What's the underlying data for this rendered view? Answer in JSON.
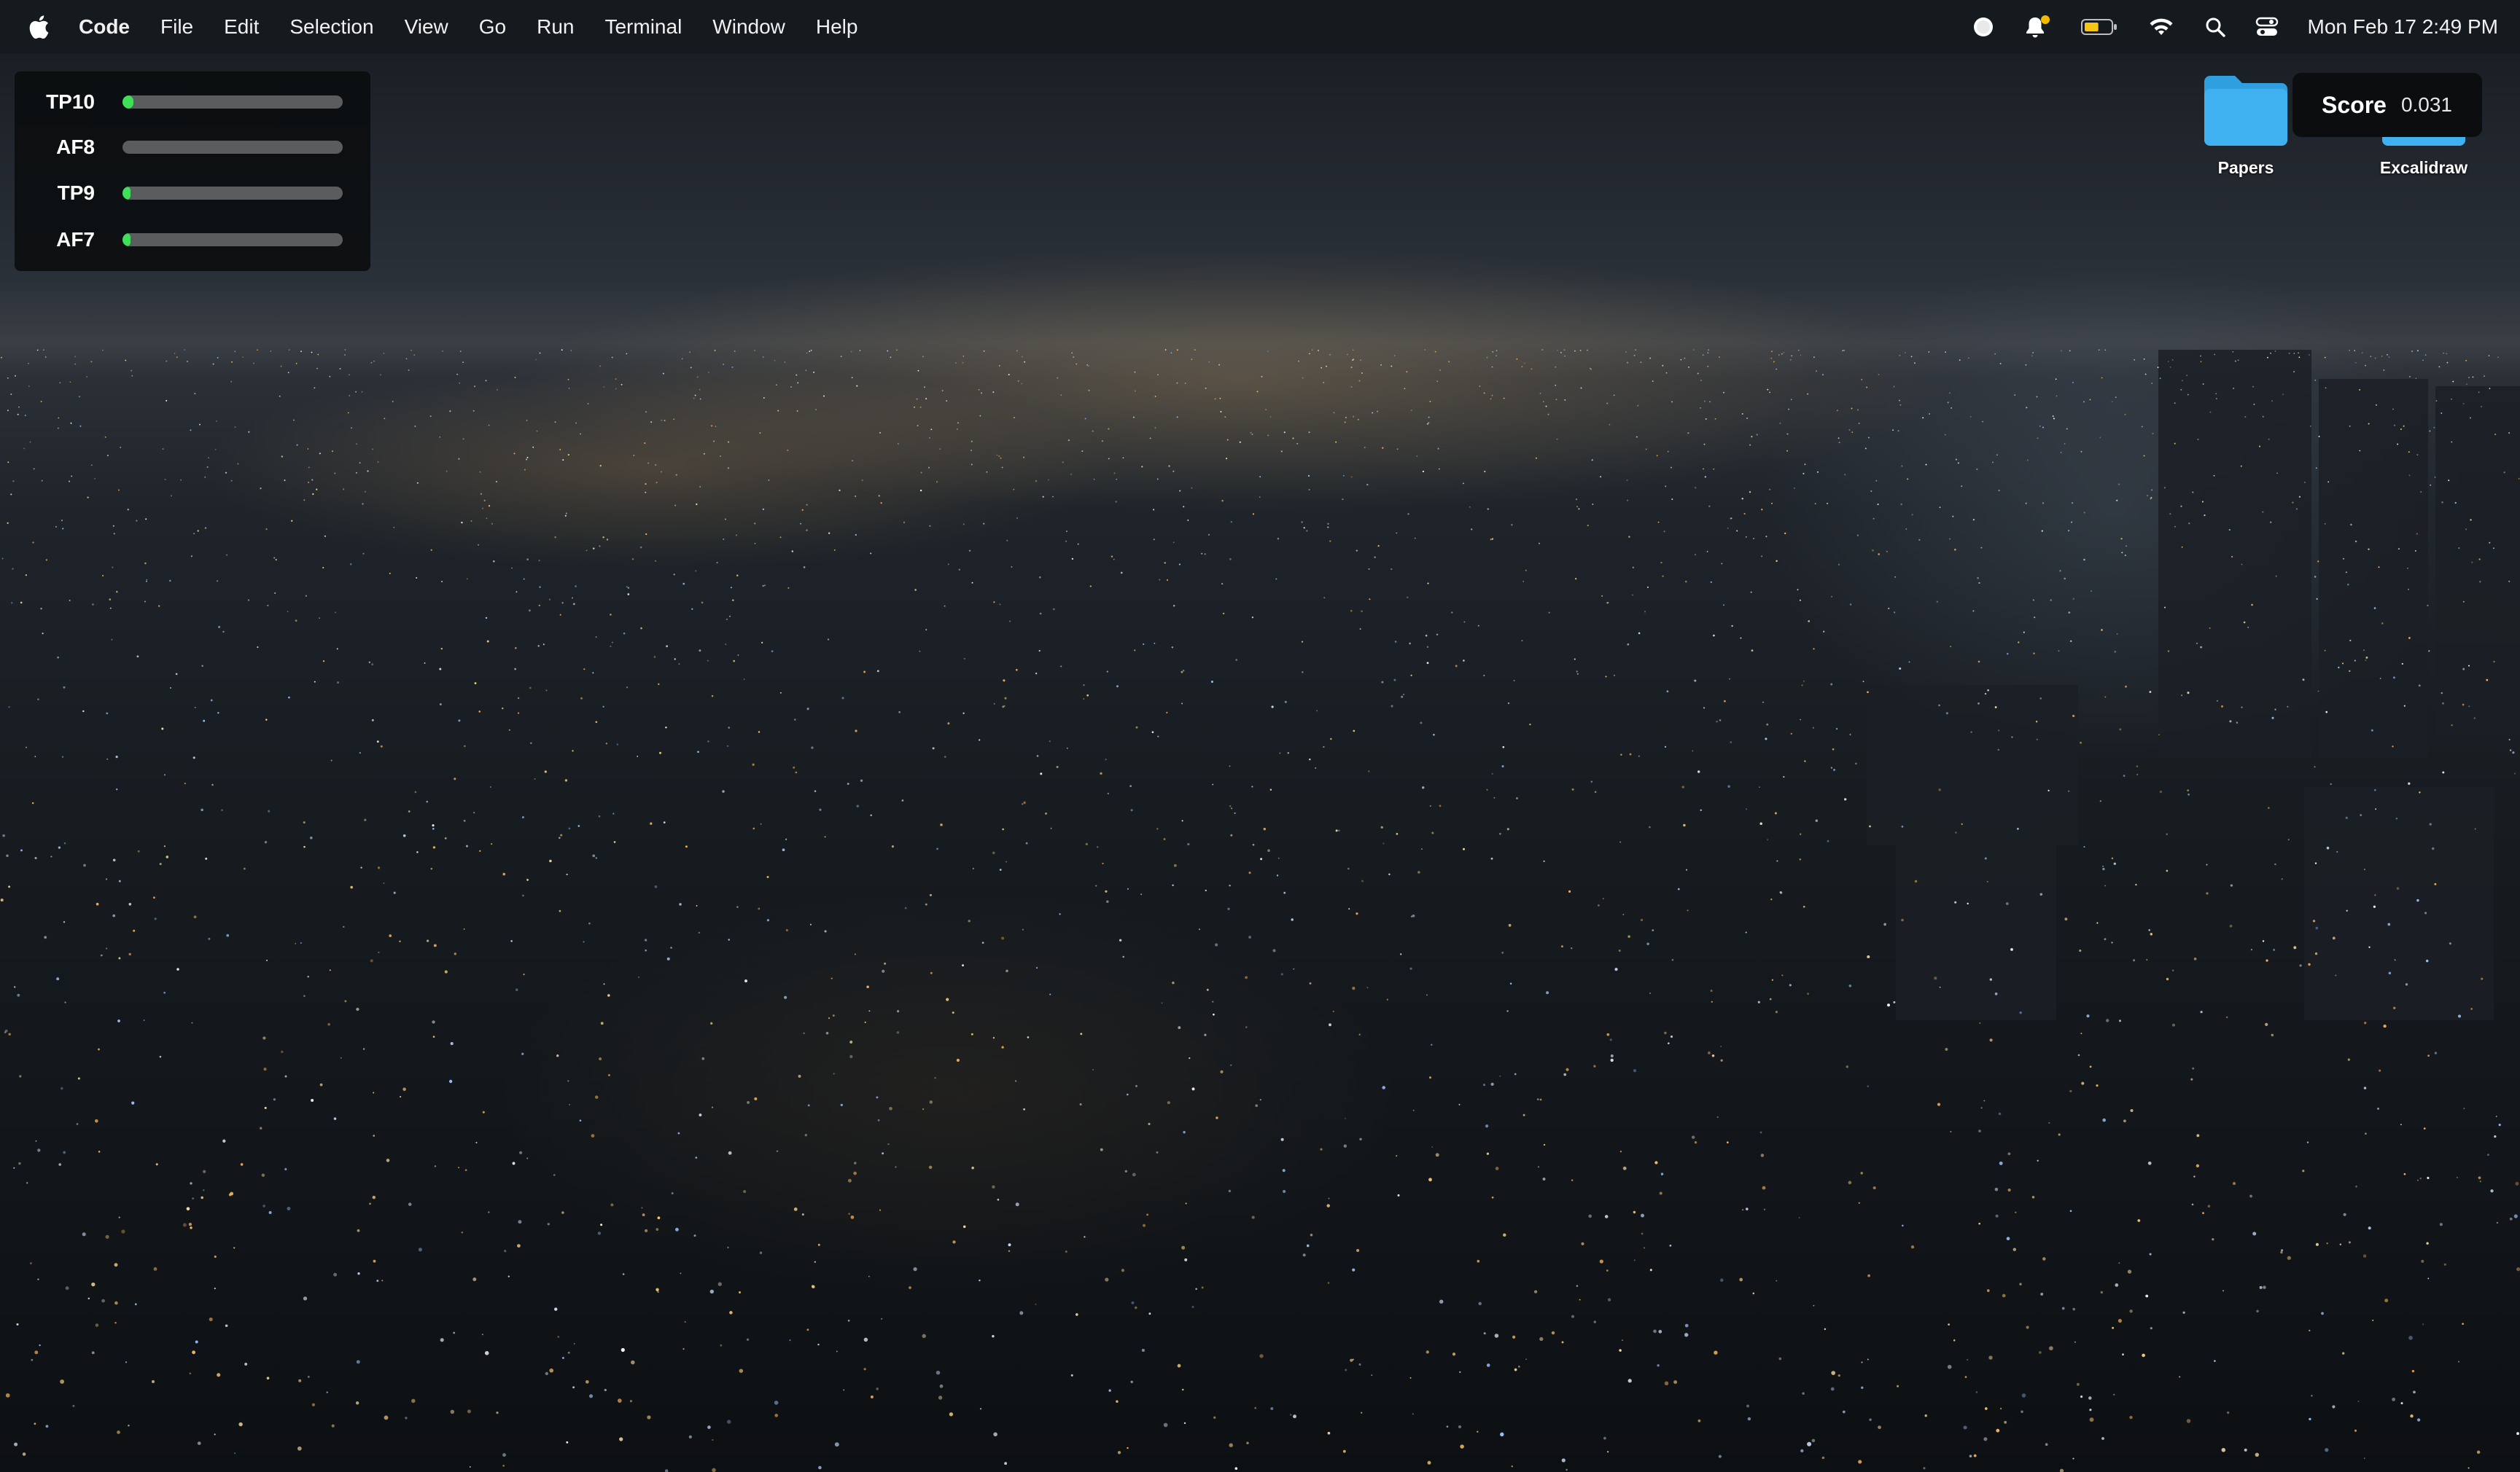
{
  "menubar": {
    "app_name": "Code",
    "items": [
      "File",
      "Edit",
      "Selection",
      "View",
      "Go",
      "Run",
      "Terminal",
      "Window",
      "Help"
    ],
    "clock": "Mon Feb 17  2:49 PM",
    "status_icons": [
      "record-icon",
      "notification-bell-icon",
      "battery-icon",
      "wifi-icon",
      "search-icon",
      "control-center-icon"
    ],
    "battery_level": 0.55,
    "battery_color": "#f5c518"
  },
  "eeg": {
    "channels": [
      {
        "name": "TP10",
        "level": 0.05
      },
      {
        "name": "AF8",
        "level": 0.0
      },
      {
        "name": "TP9",
        "level": 0.035
      },
      {
        "name": "AF7",
        "level": 0.035
      }
    ],
    "bar_color": "#3ee05a",
    "track_color": "#5a5c5e"
  },
  "desktop": {
    "icons": [
      {
        "label": "Papers",
        "icon": "folder-icon"
      },
      {
        "label": "Excalidraw",
        "icon": "folder-icon"
      }
    ],
    "folder_color": "#3fb1f0"
  },
  "score": {
    "label": "Score",
    "value": "0.031"
  }
}
